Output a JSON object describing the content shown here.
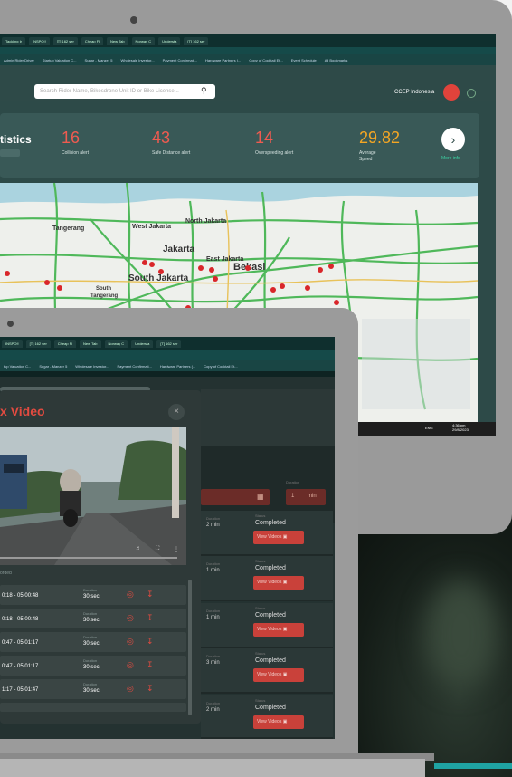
{
  "back_screen": {
    "tabs": [
      "Tackling Ir",
      "INSPO!!",
      "[T] 162 ser",
      "Cheap Fl",
      "New Tab",
      "Norway C",
      "Understa",
      "[T] 162 ser"
    ],
    "bookmarks": [
      "Admin Rider Driver",
      "Startup Valuation C...",
      "Sugar - Manzer 5",
      "Wholesale Investor...",
      "Payment Confirmati...",
      "Hardware Partners (...",
      "Copy of Cocktail Et...",
      "Event Schedule",
      "All Bookmarks"
    ],
    "search_placeholder": "Search Rider Name, Bikesdrone Unit ID or Bike License...",
    "org_name": "CCEP Indonesia",
    "stats_title": "tistics",
    "stats": [
      {
        "value": "16",
        "label": "Collision alert",
        "color": "#ef5b50"
      },
      {
        "value": "43",
        "label": "Safe Distance alert",
        "color": "#ef5b50"
      },
      {
        "value": "14",
        "label": "Overspeeding alert",
        "color": "#ef5b50"
      },
      {
        "value": "29.82",
        "label": "Average Speed",
        "color": "#f5a623"
      }
    ],
    "more_info": "More info",
    "map_labels": [
      "Tangerang",
      "West Jakarta",
      "North Jakarta",
      "Jakarta",
      "East Jakarta",
      "Bekasi",
      "South Jakarta",
      "South Tangerang"
    ],
    "taskbar_time": "4:36 pm",
    "taskbar_date": "29/8/2023",
    "taskbar_lang": "ENG"
  },
  "front_screen": {
    "tabs": [
      "INSPO!!",
      "[T] 162 ser",
      "Cheap Fl",
      "New Tab",
      "Norway C",
      "Understa",
      "[T] 162 ser"
    ],
    "bookmarks": [
      "tup Valuation C...",
      "Sugar - Manzer 5",
      "Wholesale Investor...",
      "Payment Confirmati...",
      "Hardware Partners (...",
      "Copy of Cocktail Et..."
    ],
    "modal_title": "x Video",
    "clips_label": "orded",
    "clips": [
      {
        "time": "0:18 - 05:00:48",
        "duration_label": "Duration",
        "duration": "30 sec"
      },
      {
        "time": "0:18 - 05:00:48",
        "duration_label": "Duration",
        "duration": "30 sec"
      },
      {
        "time": "0:47 - 05:01:17",
        "duration_label": "Duration",
        "duration": "30 sec"
      },
      {
        "time": "0:47 - 05:01:17",
        "duration_label": "Duration",
        "duration": "30 sec"
      },
      {
        "time": "1:17 - 05:01:47",
        "duration_label": "Duration",
        "duration": "30 sec"
      }
    ],
    "duration_filter_label": "Duration",
    "duration_filter_value": "1",
    "duration_filter_unit": "min",
    "records": [
      {
        "duration_label": "Duration",
        "duration": "2 min",
        "status_label": "Status",
        "status": "Completed",
        "button": "View Videos"
      },
      {
        "duration_label": "Duration",
        "duration": "1 min",
        "status_label": "Status",
        "status": "Completed",
        "button": "View Videos"
      },
      {
        "duration_label": "Duration",
        "duration": "1 min",
        "status_label": "Status",
        "status": "Completed",
        "button": "View Videos"
      },
      {
        "duration_label": "Duration",
        "duration": "3 min",
        "status_label": "Status",
        "status": "Completed",
        "button": "View Videos"
      },
      {
        "duration_label": "Duration",
        "duration": "2 min",
        "status_label": "Status",
        "status": "Completed",
        "button": "View Videos"
      }
    ]
  }
}
